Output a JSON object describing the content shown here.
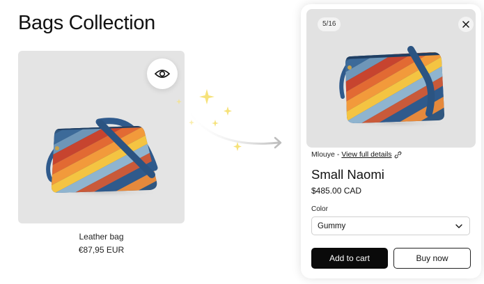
{
  "page": {
    "title": "Bags Collection"
  },
  "product_card": {
    "name": "Leather bag",
    "price": "€87,95 EUR",
    "quick_view_icon": "eye-icon"
  },
  "quick_view_modal": {
    "image_counter": "5/16",
    "close_icon": "close-icon",
    "vendor": "Mlouye",
    "vendor_separator": "-",
    "details_link": "View full details",
    "details_link_icon": "link-icon",
    "title": "Small Naomi",
    "price": "$485.00 CAD",
    "color_label": "Color",
    "color_value": "Gummy",
    "add_to_cart_label": "Add to cart",
    "buy_now_label": "Buy now"
  },
  "colors": {
    "primary": "#0a0a0a",
    "image_background": "#e2e2e2",
    "sparkle": "#f6e27a"
  }
}
